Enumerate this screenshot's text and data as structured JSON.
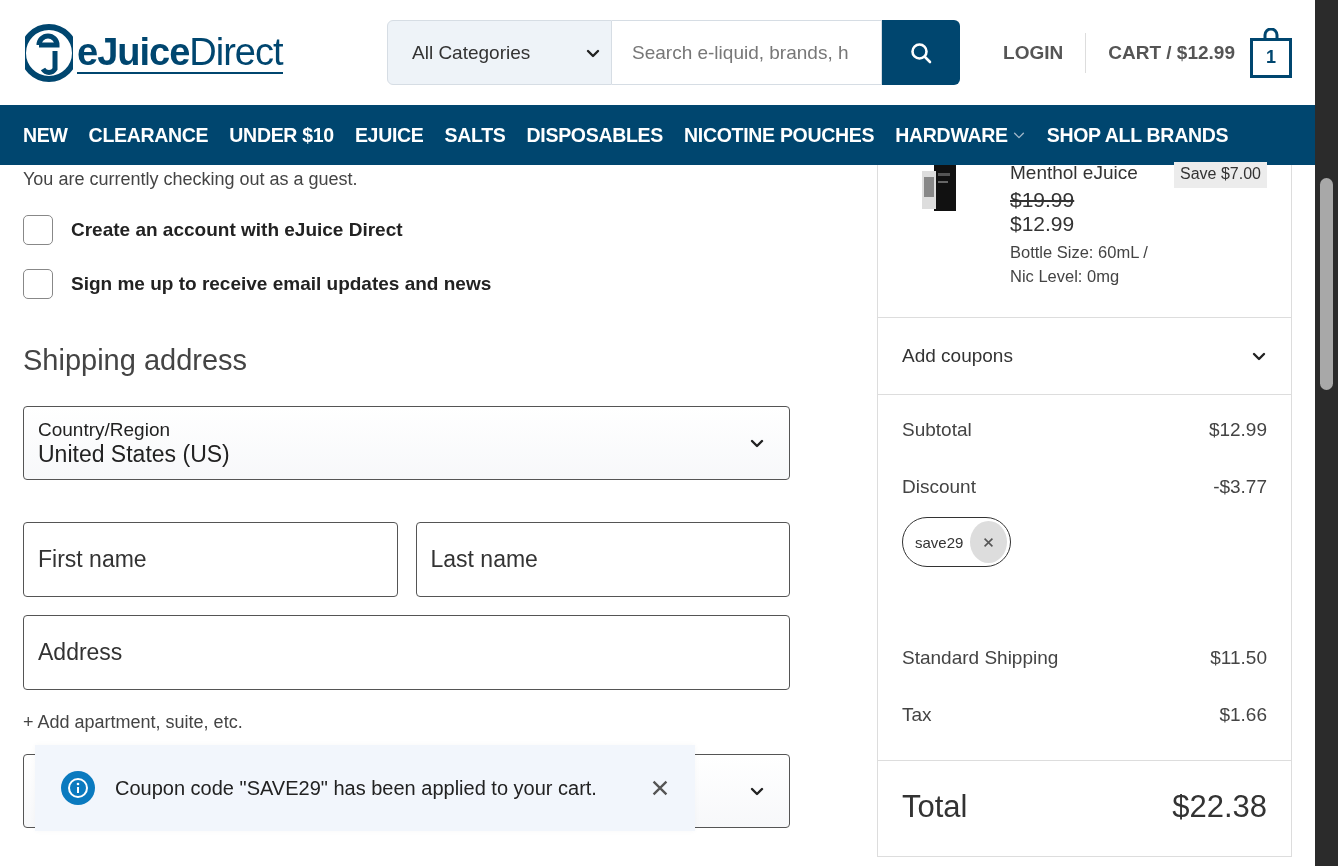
{
  "header": {
    "logo": "**eJuice**Direct",
    "category_select": "All Categories",
    "search": {
      "placeholder": "Search e-liquid, brands, h"
    },
    "login": "LOGIN",
    "cart": "CART / $12.99",
    "cart_count": "1"
  },
  "nav": [
    {
      "label": "NEW",
      "dropdown": false
    },
    {
      "label": "CLEARANCE",
      "dropdown": false
    },
    {
      "label": "UNDER $10",
      "dropdown": false
    },
    {
      "label": "EJUICE",
      "dropdown": false
    },
    {
      "label": "SALTS",
      "dropdown": false
    },
    {
      "label": "DISPOSABLES",
      "dropdown": false
    },
    {
      "label": "NICOTINE POUCHES",
      "dropdown": false
    },
    {
      "label": "HARDWARE",
      "dropdown": true
    },
    {
      "label": "SHOP ALL BRANDS",
      "dropdown": false
    }
  ],
  "guest_note": "You are currently checking out as a guest.",
  "options": [
    {
      "label": "Create an account with eJuice Direct",
      "checked": false
    },
    {
      "label": "Sign me up to receive email updates and news",
      "checked": false
    }
  ],
  "shipping": {
    "title": "Shipping address",
    "country": {
      "label": "Country/Region",
      "value": "United States (US)"
    },
    "name_fields": [
      {
        "placeholder": "First name"
      },
      {
        "placeholder": "Last name"
      }
    ],
    "address": {
      "placeholder": "Address"
    },
    "add_line": "+ Add apartment, suite, etc."
  },
  "toast": {
    "message": "Coupon code \"SAVE29\" has been applied to your cart."
  },
  "summary": {
    "item": {
      "name": "Menthol eJuice",
      "save": "Save $7.00",
      "old_price": "$19.99",
      "price": "$12.99",
      "details": "Bottle Size: 60mL / Nic Level: 0mg"
    },
    "coupons_label": "Add coupons",
    "lines": [
      {
        "label": "Subtotal",
        "value": "$12.99"
      },
      {
        "label": "Discount",
        "value": "-$3.77",
        "coupon": "save29"
      },
      {
        "label": "Standard Shipping",
        "value": "$11.50"
      },
      {
        "label": "Tax",
        "value": "$1.66"
      }
    ],
    "total": {
      "label": "Total",
      "value": "$22.38"
    }
  }
}
